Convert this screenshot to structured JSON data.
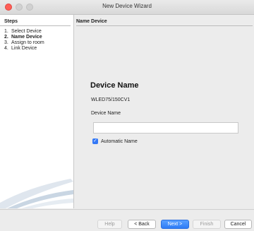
{
  "window": {
    "title": "New Device Wizard"
  },
  "steps": {
    "header": "Steps",
    "items": [
      {
        "num": "1.",
        "label": "Select Device",
        "active": false
      },
      {
        "num": "2.",
        "label": "Name Device",
        "active": true
      },
      {
        "num": "3.",
        "label": "Assign to room",
        "active": false
      },
      {
        "num": "4.",
        "label": "Link Device",
        "active": false
      }
    ]
  },
  "content": {
    "header": "Name Device",
    "device_title": "Device Name",
    "device_model": "WLED75/150CV1",
    "field_label": "Device Name",
    "field_value": "",
    "checkbox_label": "Automatic Name",
    "checkbox_checked": true
  },
  "buttons": {
    "help": "Help",
    "back": "< Back",
    "next": "Next >",
    "finish": "Finish",
    "cancel": "Cancel"
  },
  "colors": {
    "accent": "#2f7cf6",
    "close": "#ff5f57"
  }
}
